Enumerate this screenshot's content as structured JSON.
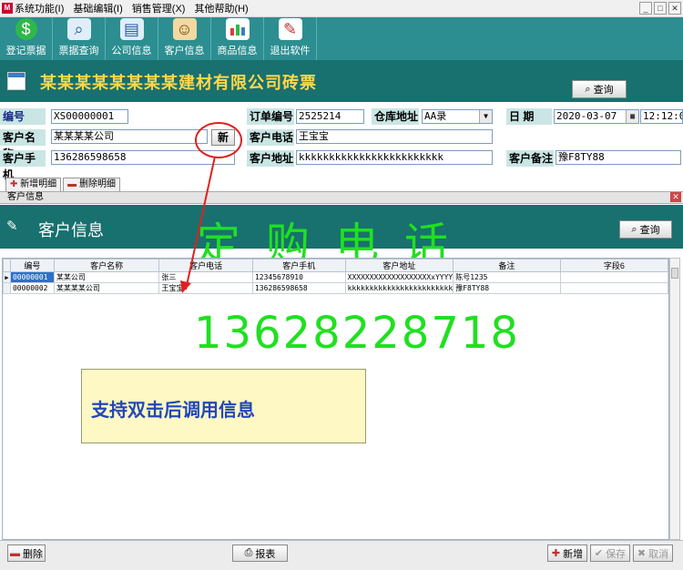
{
  "menu": {
    "app_icon": "app-logo-icon",
    "items": [
      "系统功能(I)",
      "基础编辑(I)",
      "销售管理(X)",
      "其他帮助(H)"
    ],
    "window_controls": [
      "_",
      "□",
      "✕"
    ]
  },
  "toolbar": {
    "buttons": [
      {
        "label": "登记票据",
        "icon": "dollar-coin-icon",
        "color": "#2fb84a"
      },
      {
        "label": "票据查询",
        "icon": "magnifier-icon",
        "color": "#dfeef8"
      },
      {
        "label": "公司信息",
        "icon": "building-icon",
        "color": "#dfeef8"
      },
      {
        "label": "客户信息",
        "icon": "people-icon",
        "color": "#f3d8a0"
      },
      {
        "label": "商品信息",
        "icon": "bar-chart-icon",
        "color": "#ffffff"
      },
      {
        "label": "退出软件",
        "icon": "exit-pen-icon",
        "color": "#ffffff"
      }
    ]
  },
  "header": {
    "title": "某某某某某某某某建材有限公司砖票",
    "query_label": "查询"
  },
  "form": {
    "labels": {
      "id": "编号",
      "customer_name": "客户名称",
      "customer_mobile": "客户手机",
      "order_no": "订单编号",
      "customer_phone": "客户电话",
      "customer_address": "客户地址",
      "warehouse": "仓库地址",
      "date": "日  期",
      "remark": "客户备注"
    },
    "values": {
      "id": "XS00000001",
      "customer_name": "某某某某公司",
      "customer_mobile": "13628659865​8",
      "order_no": "2525214",
      "customer_phone": "王宝宝",
      "customer_address": "kkkkkkkkkkkkkkkkkkkkkkkk",
      "warehouse": "AA录",
      "date": "2020-03-07",
      "time": "12:12:0",
      "remark": "豫F8TY88"
    },
    "new_button": "新",
    "detail_tabs": [
      "新增明细",
      "删除明细"
    ]
  },
  "child": {
    "window_title": "客户信息",
    "title": "客户信息",
    "query_label": "查询",
    "banner": "定购电话",
    "grid": {
      "columns": [
        "编号",
        "客户名称",
        "客户电话",
        "客户手机",
        "客户地址",
        "备注",
        "字段6"
      ],
      "rows": [
        [
          "00000001",
          "某某公司",
          "张三",
          "12345678910",
          "XXXXXXXXXXXXXXXXXXXxYYYY",
          "陈号1235",
          ""
        ],
        [
          "00000002",
          "某某某某公司",
          "王宝宝",
          "136286598658",
          "kkkkkkkkkkkkkkkkkkkkkkkk",
          "豫F8TY88",
          ""
        ]
      ]
    },
    "phone_overlay": "13628228718",
    "note": "支持双击后调用信息"
  },
  "bottom": {
    "delete_label": "删除",
    "report_label": "报表",
    "add_label": "新增",
    "save_label": "保存",
    "cancel_label": "取消"
  },
  "colors": {
    "toolbar": "#2c8e90",
    "header": "#18706f",
    "title": "#ffd84a",
    "overlay_green": "#20e020",
    "annotation_red": "#e02020"
  }
}
